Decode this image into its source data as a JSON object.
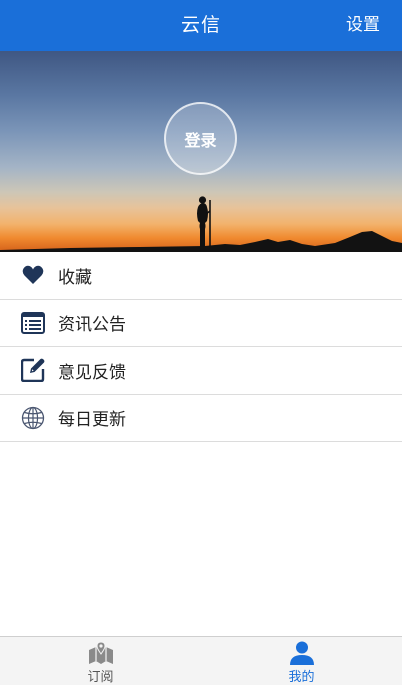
{
  "header": {
    "title": "云信",
    "settings_label": "设置"
  },
  "hero": {
    "login_label": "登录"
  },
  "menu": {
    "items": [
      {
        "label": "收藏",
        "icon": "heart-icon"
      },
      {
        "label": "资讯公告",
        "icon": "news-list-icon"
      },
      {
        "label": "意见反馈",
        "icon": "edit-feedback-icon"
      },
      {
        "label": "每日更新",
        "icon": "globe-icon"
      }
    ]
  },
  "tabbar": {
    "tabs": [
      {
        "label": "订阅",
        "icon": "map-icon",
        "active": false
      },
      {
        "label": "我的",
        "icon": "person-icon",
        "active": true
      }
    ]
  },
  "colors": {
    "brand": "#1a6fd9",
    "icon_dark": "#1f3558",
    "inactive_tab": "#555555"
  }
}
